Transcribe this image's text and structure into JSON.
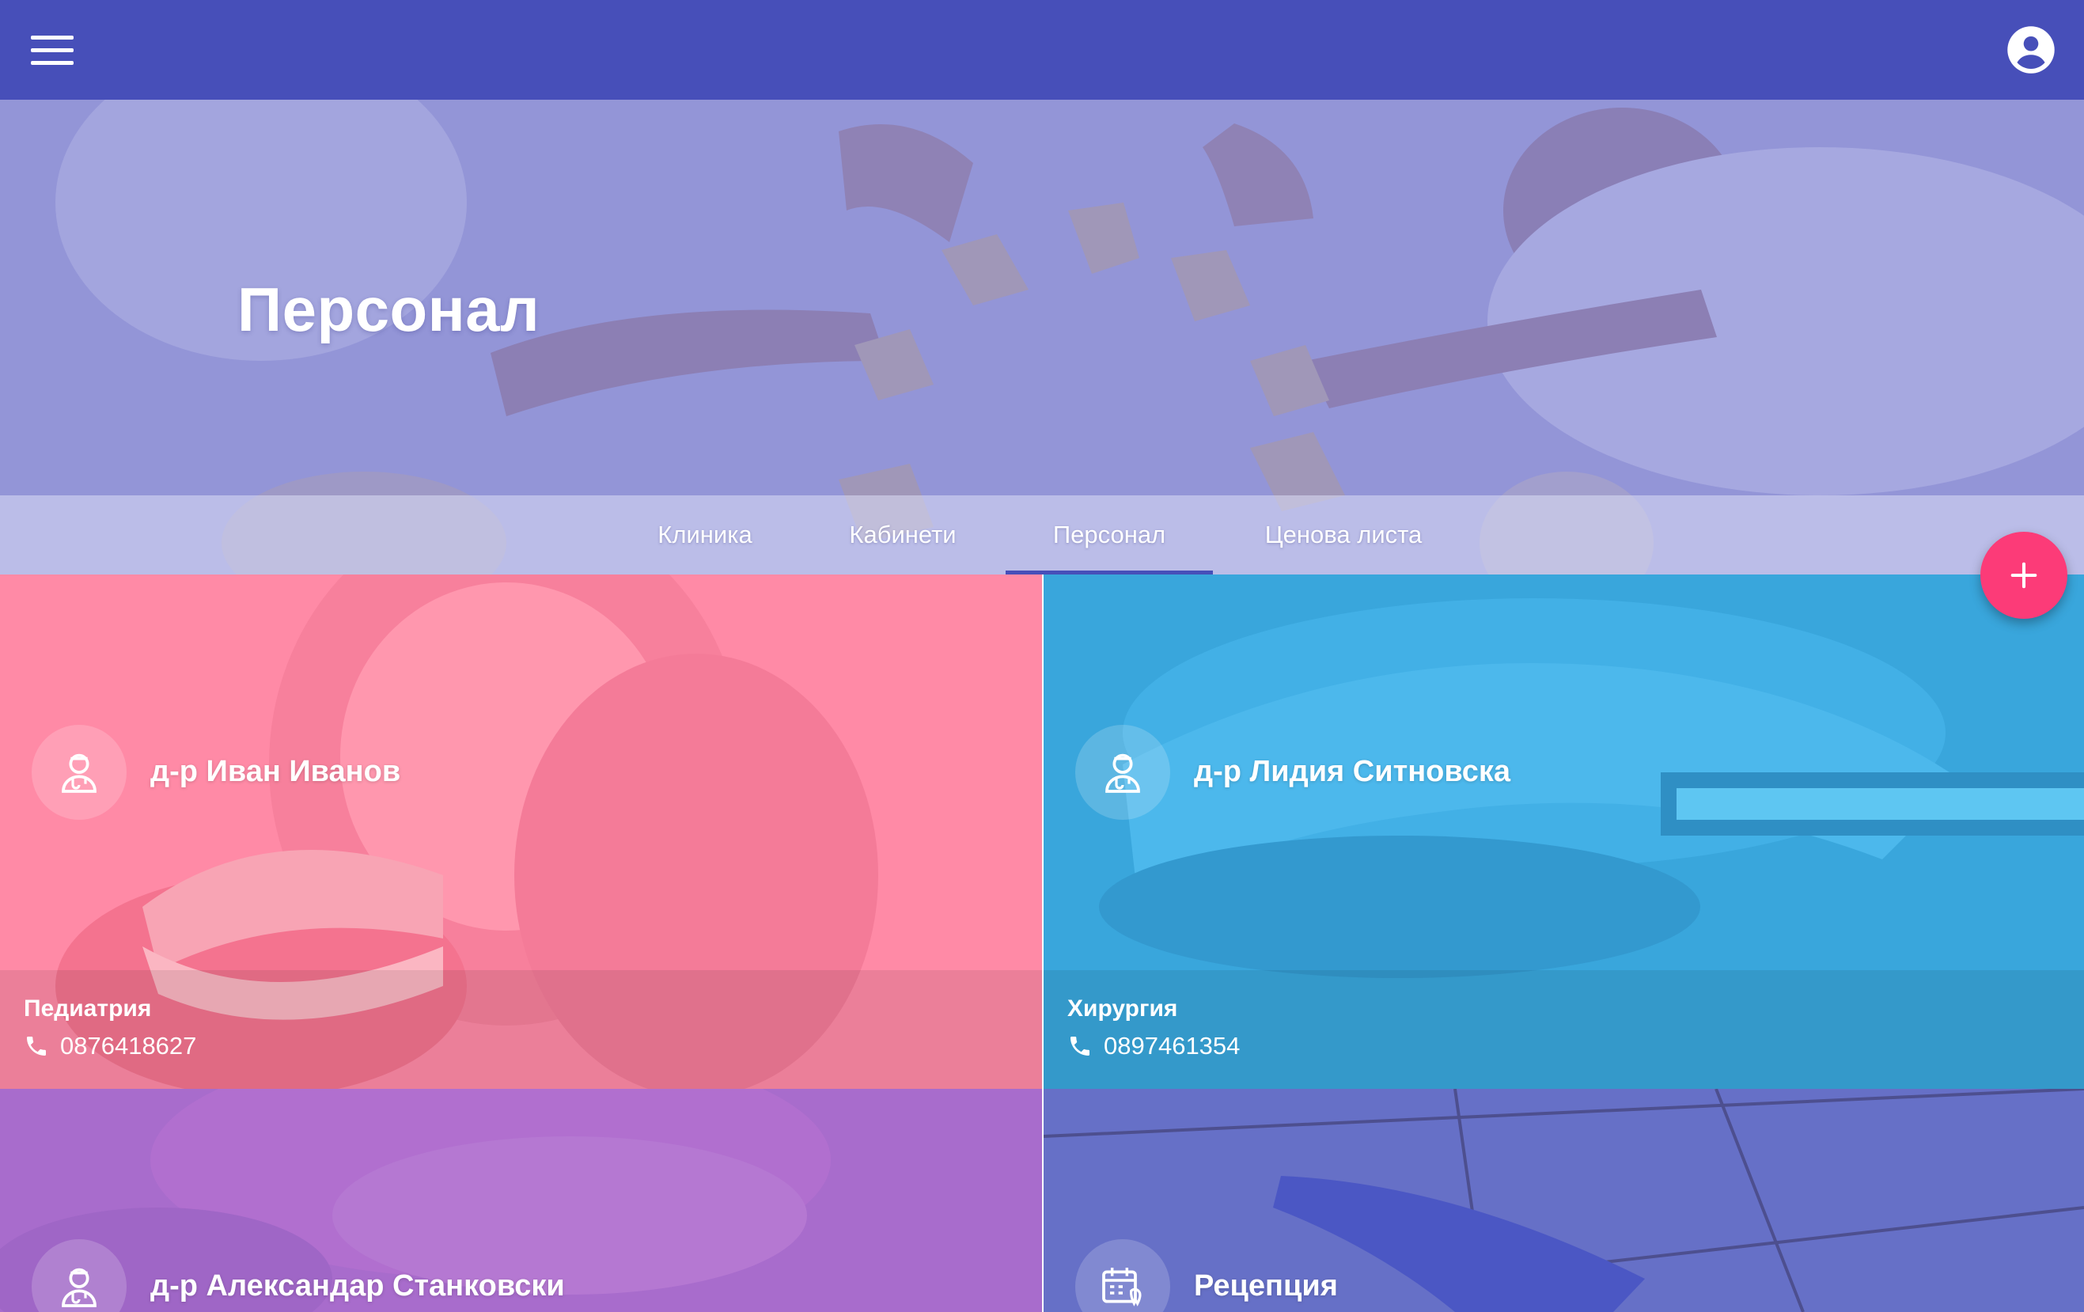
{
  "app": {
    "accent": "#474fb9",
    "fab_color": "#fc3b78",
    "menu_icon": "hamburger-menu-icon",
    "account_icon": "account-circle-icon"
  },
  "hero": {
    "title": "Персонал"
  },
  "tabs": [
    {
      "label": "Клиника",
      "active": false
    },
    {
      "label": "Кабинети",
      "active": false
    },
    {
      "label": "Персонал",
      "active": true
    },
    {
      "label": "Ценова листа",
      "active": false
    }
  ],
  "fab": {
    "icon": "plus-icon"
  },
  "staff": [
    {
      "name": "д-р Иван Иванов",
      "department": "Педиатрия",
      "phone": "0876418627",
      "color": "#ff8aa6",
      "icon": "doctor-icon"
    },
    {
      "name": "д-р Лидия Ситновска",
      "department": "Хирургия",
      "phone": "0897461354",
      "color": "#39a6dc",
      "icon": "doctor-icon"
    },
    {
      "name": "д-р Александар Станковски",
      "color": "#a86ccc",
      "icon": "doctor-icon"
    },
    {
      "name": "Рецепция",
      "color": "#6670c7",
      "icon": "calendar-tooth-icon"
    }
  ]
}
